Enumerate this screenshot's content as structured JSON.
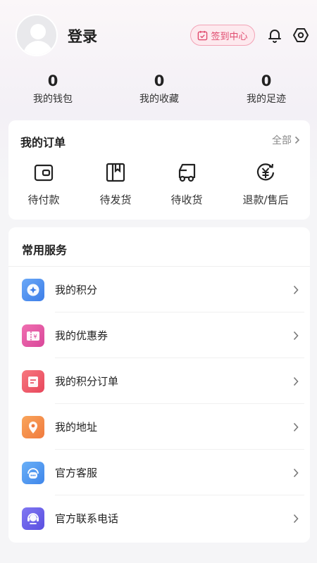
{
  "header": {
    "login_label": "登录",
    "checkin_label": "签到中心",
    "icons": [
      "calendar-check-icon",
      "bell-icon",
      "settings-icon"
    ]
  },
  "stats": [
    {
      "value": "0",
      "label": "我的钱包"
    },
    {
      "value": "0",
      "label": "我的收藏"
    },
    {
      "value": "0",
      "label": "我的足迹"
    }
  ],
  "orders": {
    "title": "我的订单",
    "all_label": "全部",
    "items": [
      {
        "label": "待付款",
        "icon": "wallet-icon"
      },
      {
        "label": "待发货",
        "icon": "package-icon"
      },
      {
        "label": "待收货",
        "icon": "truck-icon"
      },
      {
        "label": "退款/售后",
        "icon": "refund-yen-icon"
      }
    ]
  },
  "services": {
    "title": "常用服务",
    "items": [
      {
        "label": "我的积分",
        "icon": "points-icon",
        "color": "#4f8ff0"
      },
      {
        "label": "我的优惠券",
        "icon": "coupon-icon",
        "color": "#e8579c"
      },
      {
        "label": "我的积分订单",
        "icon": "points-order-icon",
        "color": "#f0566b"
      },
      {
        "label": "我的地址",
        "icon": "location-pin-icon",
        "color": "#f48a4c"
      },
      {
        "label": "官方客服",
        "icon": "customer-service-icon",
        "color": "#4e97f0"
      },
      {
        "label": "官方联系电话",
        "icon": "phone-headset-icon",
        "color": "#6a62e8"
      }
    ]
  },
  "colors": {
    "accent_pink": "#e04a6e",
    "background": "#f5f5f7"
  }
}
